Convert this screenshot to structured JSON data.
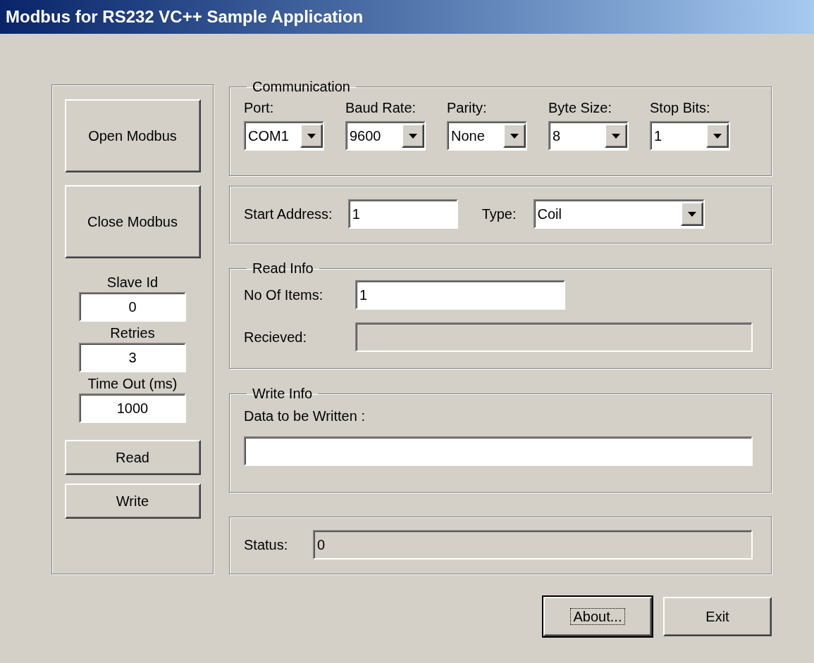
{
  "window": {
    "title": "Modbus for RS232 VC++ Sample Application"
  },
  "left_panel": {
    "open_button": "Open Modbus",
    "close_button": "Close Modbus",
    "fields": [
      {
        "label": "Slave Id",
        "value": "0"
      },
      {
        "label": "Retries",
        "value": "3"
      },
      {
        "label": "Time Out (ms)",
        "value": "1000"
      }
    ],
    "read_button": "Read",
    "write_button": "Write"
  },
  "communication": {
    "title": "Communication",
    "fields": [
      {
        "label": "Port:",
        "value": "COM1"
      },
      {
        "label": "Baud Rate:",
        "value": "9600"
      },
      {
        "label": "Parity:",
        "value": "None"
      },
      {
        "label": "Byte Size:",
        "value": "8"
      },
      {
        "label": "Stop Bits:",
        "value": "1"
      }
    ]
  },
  "address": {
    "start_label": "Start Address:",
    "start_value": "1",
    "type_label": "Type:",
    "type_value": "Coil"
  },
  "read_info": {
    "title": "Read Info",
    "items_label": "No Of Items:",
    "items_value": "1",
    "received_label": "Recieved:",
    "received_disabled": true
  },
  "write_info": {
    "title": "Write Info",
    "data_label": "Data to be Written :"
  },
  "status": {
    "label": "Status:",
    "value": "0",
    "disabled": true
  },
  "buttons": [
    {
      "label": "About...",
      "focused": true
    },
    {
      "label": "Exit",
      "focused": false
    }
  ]
}
